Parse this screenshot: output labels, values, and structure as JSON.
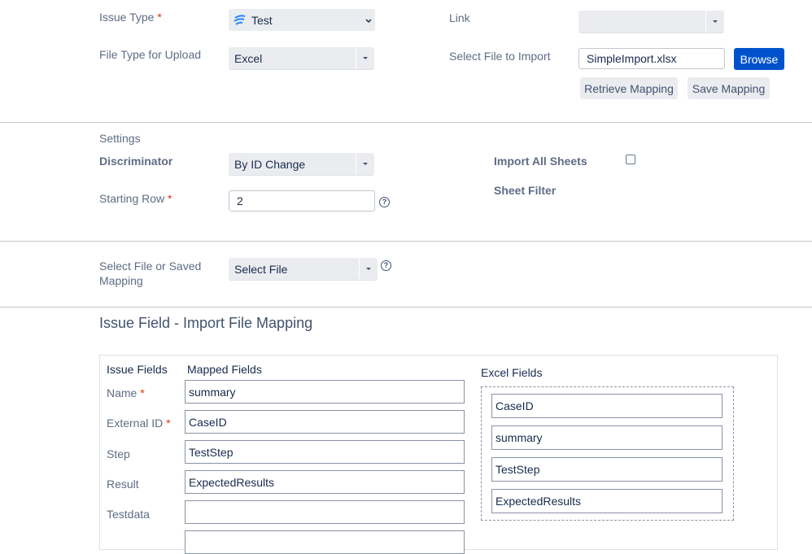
{
  "top": {
    "issue_type_label": "Issue Type",
    "issue_type_value": "Test",
    "link_label": "Link",
    "link_value": "",
    "file_type_label": "File Type for Upload",
    "file_type_value": "Excel",
    "select_file_label": "Select File to Import",
    "file_name": "SimpleImport.xlsx",
    "browse_label": "Browse",
    "retrieve_mapping_label": "Retrieve Mapping",
    "save_mapping_label": "Save Mapping",
    "required_mark": "*"
  },
  "settings": {
    "heading": "Settings",
    "discriminator_label": "Discriminator",
    "discriminator_value": "By ID Change",
    "starting_row_label": "Starting Row",
    "starting_row_value": "2",
    "import_all_sheets_label": "Import All Sheets",
    "import_all_sheets_checked": false,
    "sheet_filter_label": "Sheet Filter",
    "help_glyph": "?"
  },
  "source": {
    "label_line1": "Select File or Saved",
    "label_line2": "Mapping",
    "value": "Select File"
  },
  "mapping": {
    "title": "Issue Field - Import File Mapping",
    "issue_fields_header": "Issue Fields",
    "mapped_fields_header": "Mapped Fields",
    "excel_fields_header": "Excel Fields",
    "rows": [
      {
        "field": "Name",
        "required": true,
        "mapped": "summary"
      },
      {
        "field": "External ID",
        "required": true,
        "mapped": "CaseID"
      },
      {
        "field": "Step",
        "required": false,
        "mapped": "TestStep"
      },
      {
        "field": "Result",
        "required": false,
        "mapped": "ExpectedResults"
      },
      {
        "field": "Testdata",
        "required": false,
        "mapped": ""
      }
    ],
    "excel_fields": [
      "CaseID",
      "summary",
      "TestStep",
      "ExpectedResults"
    ]
  },
  "colors": {
    "primary": "#0052cc",
    "required": "#de350b",
    "issue_icon": "#2684ff"
  },
  "icons": {
    "issue_type_icon": "test-issue-icon",
    "caret": "chevron-down-icon",
    "help": "help-icon"
  }
}
